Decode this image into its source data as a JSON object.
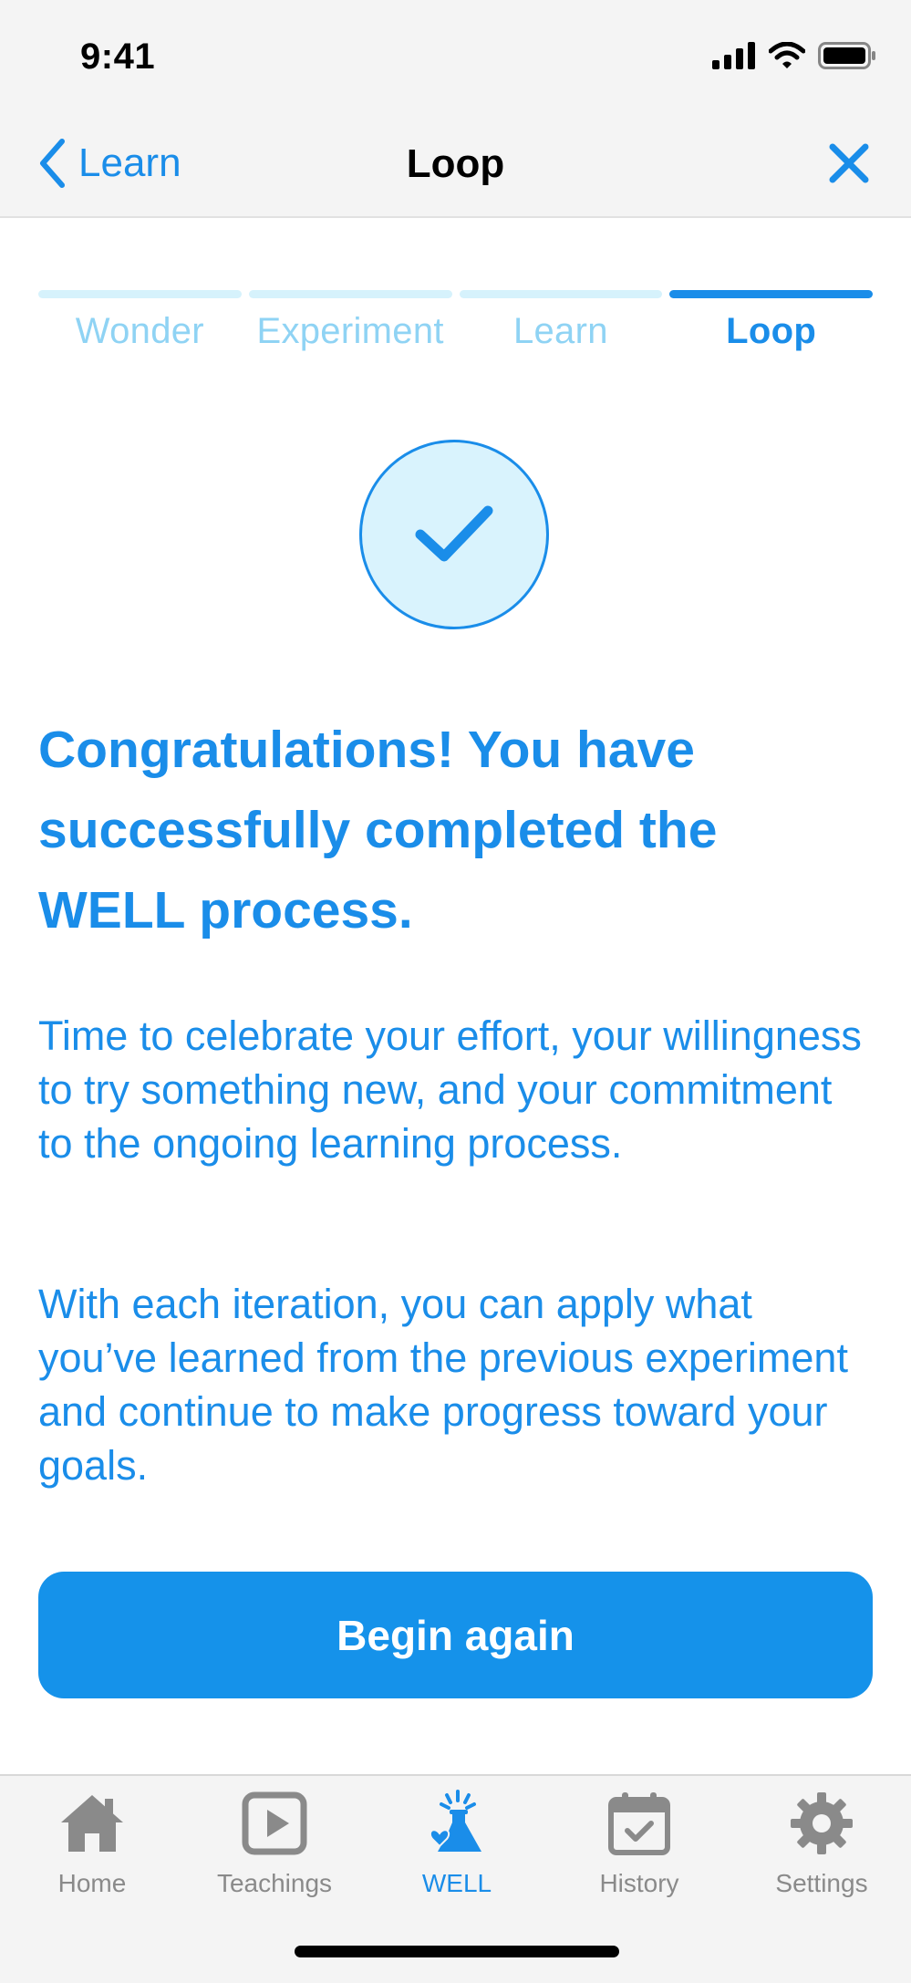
{
  "status_bar": {
    "time": "9:41"
  },
  "nav": {
    "back_label": "Learn",
    "title": "Loop"
  },
  "stepper": {
    "steps": [
      {
        "label": "Wonder",
        "active": false
      },
      {
        "label": "Experiment",
        "active": false
      },
      {
        "label": "Learn",
        "active": false
      },
      {
        "label": "Loop",
        "active": true
      }
    ]
  },
  "main": {
    "headline": "Congratulations! You have successfully completed the WELL process.",
    "paragraph_1": "Time to celebrate your effort, your willingness to try something new, and your commitment to the ongoing learning process.",
    "paragraph_2": "With each iteration, you can apply what you’ve learned from the previous experiment and continue to make progress toward your goals.",
    "button_label": "Begin again"
  },
  "tab_bar": {
    "tabs": [
      {
        "label": "Home",
        "icon": "house-icon"
      },
      {
        "label": "Teachings",
        "icon": "play-icon"
      },
      {
        "label": "WELL",
        "icon": "flask-icon",
        "active": true
      },
      {
        "label": "History",
        "icon": "calendar-check-icon"
      },
      {
        "label": "Settings",
        "icon": "gear-icon"
      }
    ]
  },
  "colors": {
    "accent": "#1a8de9",
    "inactive": "#8a8a8a",
    "step_inactive": "#8fd3f4"
  }
}
